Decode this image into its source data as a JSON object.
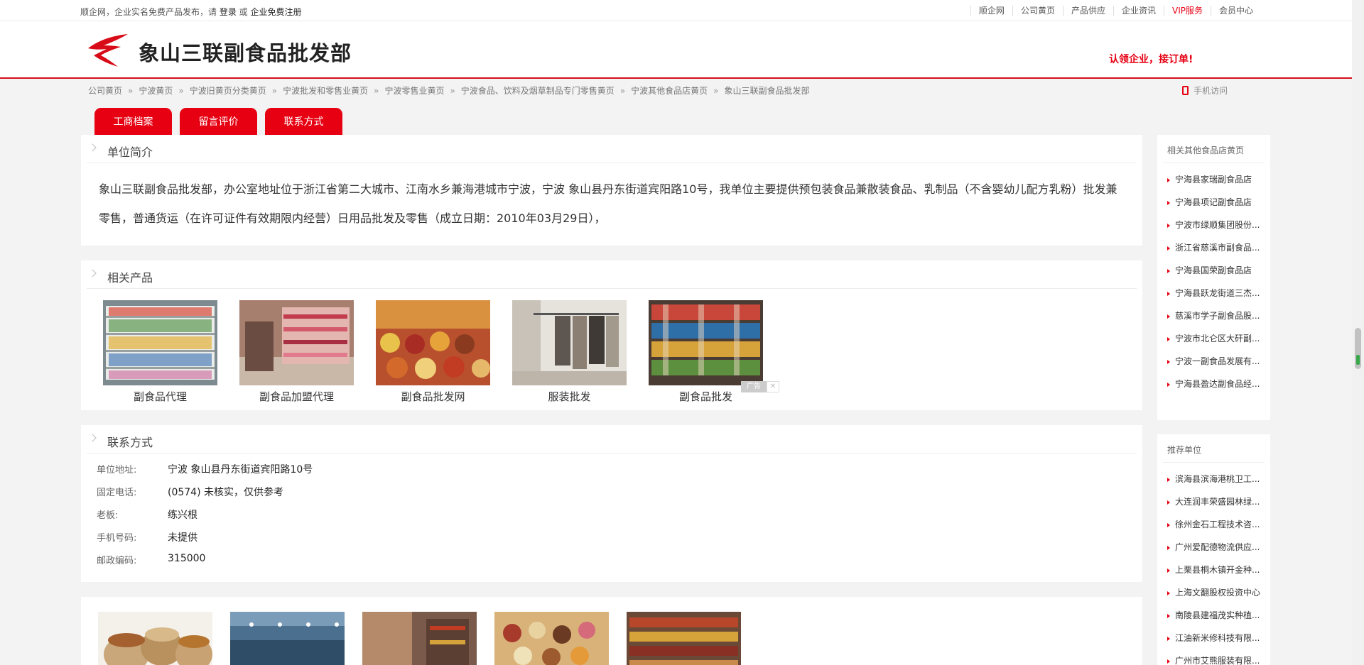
{
  "topbar": {
    "notice_prefix": "顺企网，企业实名免费产品发布，请 ",
    "login": "登录",
    "or": " 或 ",
    "register": "企业免费注册",
    "links": [
      "顺企网",
      "公司黄页",
      "产品供应",
      "企业资讯",
      "VIP服务",
      "会员中心"
    ]
  },
  "header": {
    "company_name": "象山三联副食品批发部",
    "claim_text": "认领企业，接订单!"
  },
  "breadcrumb": [
    "公司黄页",
    "宁波黄页",
    "宁波旧黄页分类黄页",
    "宁波批发和零售业黄页",
    "宁波零售业黄页",
    "宁波食品、饮料及烟草制品专门零售黄页",
    "宁波其他食品店黄页",
    "象山三联副食品批发部"
  ],
  "mobile_visit": "手机访问",
  "tabs": [
    "工商档案",
    "留言评价",
    "联系方式"
  ],
  "intro": {
    "title": "单位简介",
    "text": "象山三联副食品批发部，办公室地址位于浙江省第二大城市、江南水乡兼海港城市宁波，宁波 象山县丹东街道宾阳路10号，我单位主要提供预包装食品兼散装食品、乳制品（不含婴幼儿配方乳粉）批发兼零售，普通货运（在许可证件有效期限内经营）日用品批发及零售（成立日期：2010年03月29日），"
  },
  "products": {
    "title": "相关产品",
    "items": [
      "副食品代理",
      "副食品加盟代理",
      "副食品批发网",
      "服装批发",
      "副食品批发"
    ],
    "ad_label": "广告",
    "ad_close": "✕"
  },
  "contact": {
    "title": "联系方式",
    "rows": [
      {
        "label": "单位地址:",
        "value": "宁波 象山县丹东街道宾阳路10号"
      },
      {
        "label": "固定电话:",
        "value": "(0574) 未核实，仅供参考"
      },
      {
        "label": "老板:",
        "value": "练兴根"
      },
      {
        "label": "手机号码:",
        "value": "未提供"
      },
      {
        "label": "邮政编码:",
        "value": "315000"
      }
    ]
  },
  "sidebar": {
    "related_title": "相关其他食品店黄页",
    "related": [
      "宁海县家瑞副食品店",
      "宁海县项记副食品店",
      "宁波市绿顺集团股份...",
      "浙江省慈溪市副食品...",
      "宁海县国荣副食品店",
      "宁海县跃龙街道三杰...",
      "慈溪市学子副食品股...",
      "宁波市北仑区大矸副...",
      "宁波一副食品发展有...",
      "宁海县盈达副食品经..."
    ],
    "recommend_title": "推荐单位",
    "recommend": [
      "滨海县滨海港桃卫工...",
      "大连润丰荣盛园林绿...",
      "徐州金石工程技术咨...",
      "广州爱配德物流供应...",
      "上栗县桐木镇开金种...",
      "上海文翻股权投资中心",
      "南陵县建福茂实种植...",
      "江油新米修科技有限...",
      "广州市艾熊服装有限..."
    ]
  },
  "colors": {
    "accent": "#e60012",
    "header_line": "#d80c18"
  }
}
